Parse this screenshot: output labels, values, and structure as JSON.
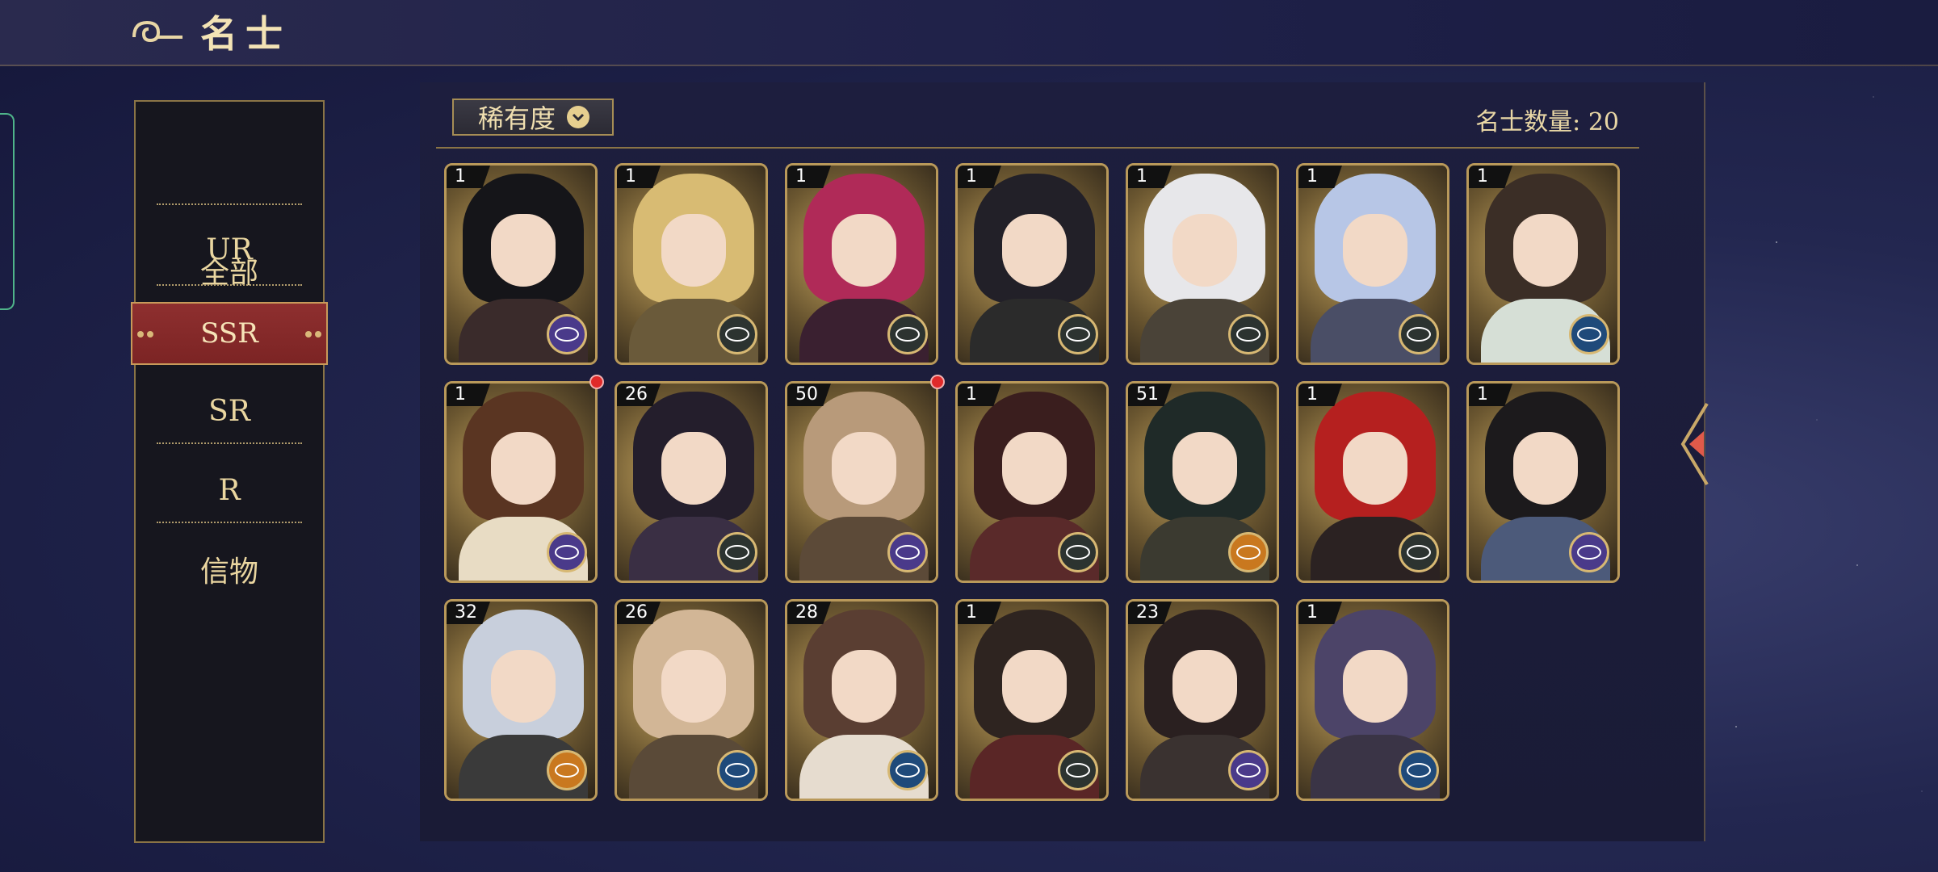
{
  "header": {
    "title": "名士"
  },
  "sidebar": {
    "items": [
      {
        "label": "全部"
      },
      {
        "label": "UR"
      },
      {
        "label": "SSR",
        "active": true
      },
      {
        "label": "SR"
      },
      {
        "label": "R"
      },
      {
        "label": "信物"
      }
    ]
  },
  "toolbar": {
    "filter_label": "稀有度",
    "count_text": "名士数量: 20"
  },
  "cards": [
    {
      "level": "1",
      "element": "purple",
      "hair": "#151519",
      "body": "#3a2b2b"
    },
    {
      "level": "1",
      "element": "dark",
      "hair": "#d8bb73",
      "body": "#6a5a3a"
    },
    {
      "level": "1",
      "element": "dark",
      "hair": "#b02a58",
      "body": "#3a2030"
    },
    {
      "level": "1",
      "element": "dark",
      "hair": "#222028",
      "body": "#2b2b2b"
    },
    {
      "level": "1",
      "element": "dark",
      "hair": "#e7e7ea",
      "body": "#4a4338"
    },
    {
      "level": "1",
      "element": "dark",
      "hair": "#b7c6e6",
      "body": "#4a4e66"
    },
    {
      "level": "1",
      "element": "blue",
      "hair": "#3b2e26",
      "body": "#d6dfd6"
    },
    {
      "level": "1",
      "element": "purple",
      "hair": "#5a3522",
      "body": "#e8dcc4",
      "red_dot": true
    },
    {
      "level": "26",
      "element": "dark",
      "hair": "#241e2c",
      "body": "#3a2f44"
    },
    {
      "level": "50",
      "element": "purple",
      "hair": "#b89a7a",
      "body": "#5c4a38",
      "red_dot": true
    },
    {
      "level": "1",
      "element": "dark",
      "hair": "#3a1e1e",
      "body": "#5a2a2a"
    },
    {
      "level": "51",
      "element": "orange",
      "hair": "#1f2a28",
      "body": "#3b3a30"
    },
    {
      "level": "1",
      "element": "dark",
      "hair": "#b5201f",
      "body": "#2b2222"
    },
    {
      "level": "1",
      "element": "purple",
      "hair": "#1c1a1c",
      "body": "#4c5a7a"
    },
    {
      "level": "32",
      "element": "orange",
      "hair": "#c8cfdc",
      "body": "#3a3a3a"
    },
    {
      "level": "26",
      "element": "blue",
      "hair": "#d2b696",
      "body": "#5a4a38"
    },
    {
      "level": "28",
      "element": "blue",
      "hair": "#5a3e32",
      "body": "#e6dccf"
    },
    {
      "level": "1",
      "element": "dark",
      "hair": "#2e2420",
      "body": "#5a2626"
    },
    {
      "level": "23",
      "element": "purple",
      "hair": "#2a2020",
      "body": "#3a3230"
    },
    {
      "level": "1",
      "element": "blue",
      "hair": "#4c4468",
      "body": "#3a3446"
    }
  ],
  "colors": {
    "purple": "#4a3a8a",
    "dark": "#2c3330",
    "blue": "#1f4a7a",
    "orange": "#c9781f"
  }
}
